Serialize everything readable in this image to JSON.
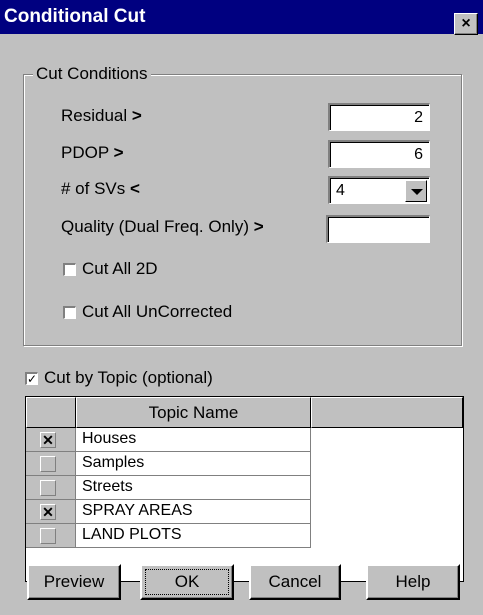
{
  "window": {
    "title": "Conditional Cut",
    "close_glyph": "×"
  },
  "group": {
    "title": "Cut Conditions"
  },
  "fields": {
    "residual": {
      "label": "Residual",
      "op": ">",
      "value": "2"
    },
    "pdop": {
      "label": "PDOP",
      "op": ">",
      "value": "6"
    },
    "svs": {
      "label": "# of SVs",
      "op": "<",
      "value": "4"
    },
    "quality": {
      "label": "Quality (Dual Freq. Only)",
      "op": ">",
      "value": ""
    }
  },
  "checks": {
    "cut_all_2d": {
      "label": "Cut All 2D",
      "checked": false
    },
    "cut_all_uncorrected": {
      "label": "Cut All UnCorrected",
      "checked": false
    },
    "cut_by_topic": {
      "label": "Cut by Topic (optional)",
      "checked": true
    }
  },
  "grid": {
    "header": "Topic Name",
    "rows": [
      {
        "name": "Houses",
        "checked": true,
        "mark": "✕"
      },
      {
        "name": "Samples",
        "checked": false,
        "mark": ""
      },
      {
        "name": "Streets",
        "checked": false,
        "mark": ""
      },
      {
        "name": "SPRAY AREAS",
        "checked": true,
        "mark": "✕"
      },
      {
        "name": "LAND PLOTS",
        "checked": false,
        "mark": ""
      }
    ]
  },
  "buttons": {
    "preview": "Preview",
    "ok": "OK",
    "cancel": "Cancel",
    "help": "Help"
  },
  "colors": {
    "titlebar": "#000080",
    "face": "#c0c0c0",
    "field": "#ffffff"
  },
  "icons": {
    "close": "close-icon",
    "dropdown": "chevron-down-icon",
    "check": "check-icon"
  }
}
